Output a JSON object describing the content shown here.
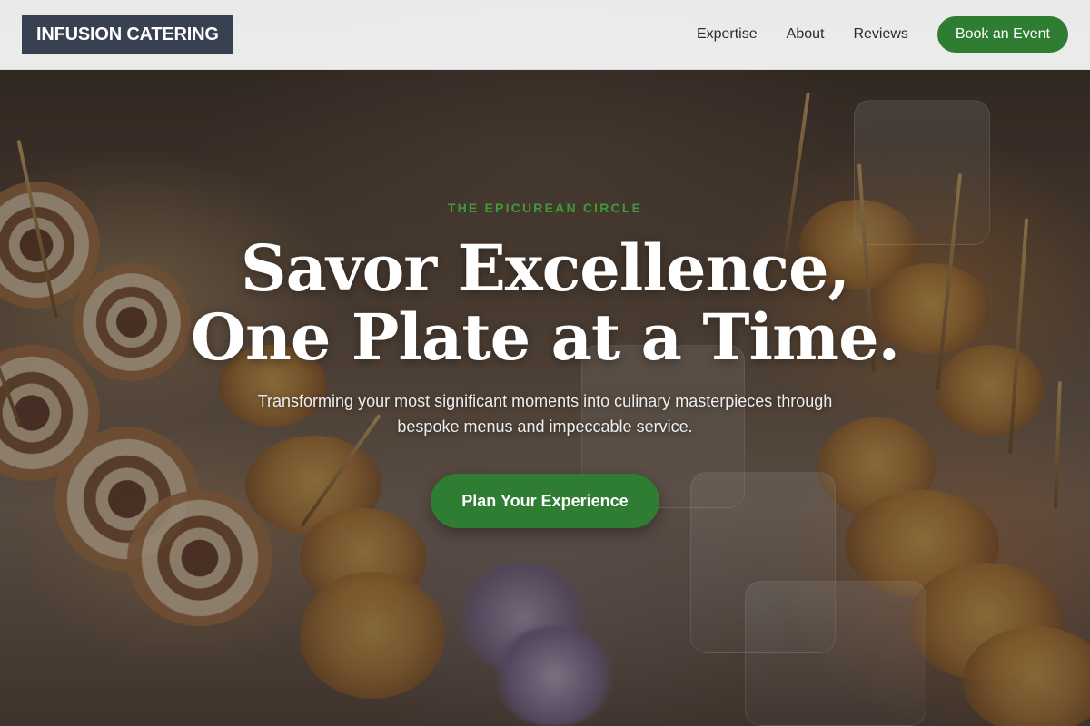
{
  "header": {
    "logo_text": "INFUSION CATERING",
    "nav": [
      {
        "label": "Expertise"
      },
      {
        "label": "About"
      },
      {
        "label": "Reviews"
      }
    ],
    "cta_label": "Book an Event"
  },
  "hero": {
    "eyebrow": "THE EPICUREAN CIRCLE",
    "headline": "Savor Excellence, One Plate at a Time.",
    "subtitle": "Transforming your most significant moments into culinary masterpieces through bespoke menus and impeccable service.",
    "cta_label": "Plan Your Experience",
    "background_image": "catering-appetizers-photo"
  },
  "colors": {
    "accent_green": "#2e7d32",
    "eyebrow_green": "#3e9a3a",
    "logo_bg": "#374151",
    "header_bg": "#f6f6f6"
  }
}
